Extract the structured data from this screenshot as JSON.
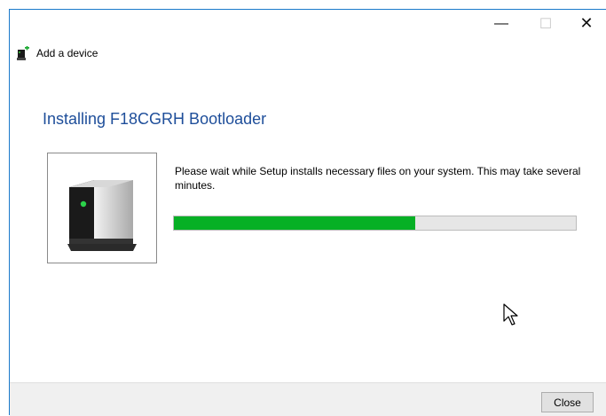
{
  "window": {
    "app_title": "Add a device",
    "controls": {
      "minimize": "—",
      "maximize": "☐",
      "close": "✕"
    }
  },
  "main": {
    "heading": "Installing F18CGRH Bootloader",
    "message": "Please wait while Setup installs necessary files on your system. This may take several minutes.",
    "progress": 0.6
  },
  "footer": {
    "close_label": "Close"
  },
  "icons": {
    "app": "add-device-icon",
    "device": "device-icon",
    "cursor": "mouse-pointer-icon"
  },
  "colors": {
    "heading": "#1e4e9a",
    "progress_fill": "#06b025",
    "progress_track": "#e6e6e6",
    "accent_border": "#1979ca"
  }
}
